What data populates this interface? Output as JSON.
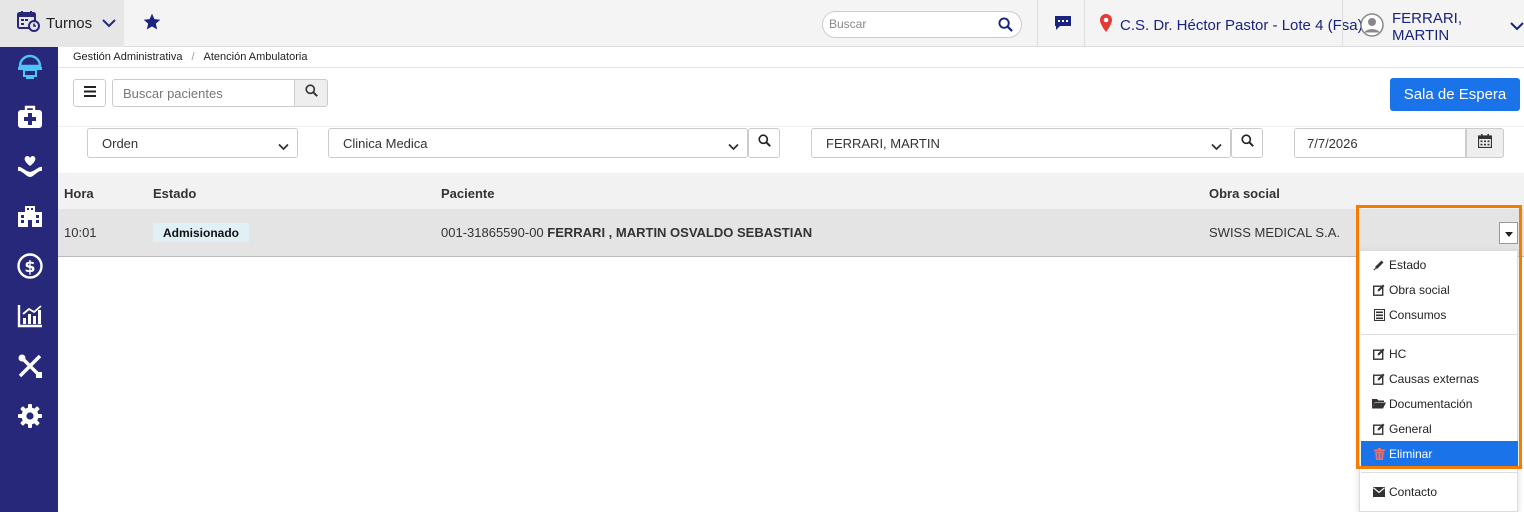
{
  "topbar": {
    "module_label": "Turnos",
    "search_placeholder": "Buscar",
    "location": "C.S. Dr. Héctor Pastor - Lote 4 (Fsa)",
    "user_name": "FERRARI, MARTIN"
  },
  "breadcrumb": [
    "Gestión Administrativa",
    "Atención Ambulatoria"
  ],
  "toolbar": {
    "patient_search_placeholder": "Buscar pacientes",
    "sala_button": "Sala de Espera"
  },
  "filters": {
    "order": "Orden",
    "specialty": "Clinica Medica",
    "professional": "FERRARI, MARTIN",
    "date": "7/7/2026"
  },
  "table": {
    "headers": [
      "Hora",
      "Estado",
      "Paciente",
      "Obra social"
    ],
    "rows": [
      {
        "hora": "10:01",
        "estado": "Admisionado",
        "paciente_id": "001-31865590-00",
        "paciente_nombre": "FERRARI , MARTIN OSVALDO SEBASTIAN",
        "obra_social": "SWISS MEDICAL S.A."
      }
    ]
  },
  "dropdown": {
    "items": [
      {
        "label": "Estado",
        "icon": "pencil-icon"
      },
      {
        "label": "Obra social",
        "icon": "edit-icon"
      },
      {
        "label": "Consumos",
        "icon": "list-icon"
      },
      {
        "label": "HC",
        "icon": "edit-icon"
      },
      {
        "label": "Causas externas",
        "icon": "edit-icon"
      },
      {
        "label": "Documentación",
        "icon": "folder-icon"
      },
      {
        "label": "General",
        "icon": "edit-icon"
      },
      {
        "label": "Eliminar",
        "icon": "trash-icon"
      },
      {
        "label": "Contacto",
        "icon": "envelope-icon"
      }
    ]
  },
  "colors": {
    "sidebar": "#27287a",
    "primary": "#1a73e8",
    "highlight": "#f57c00"
  }
}
